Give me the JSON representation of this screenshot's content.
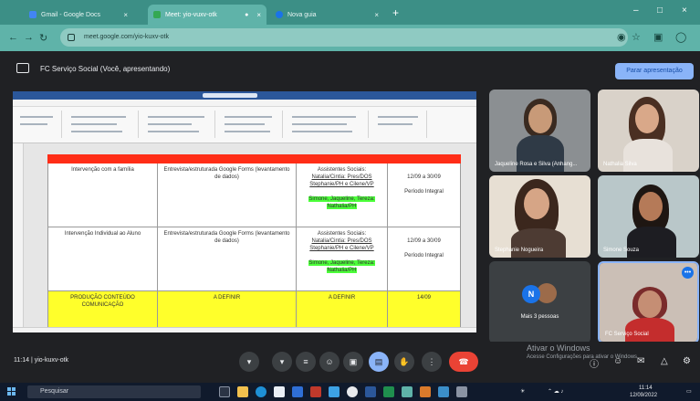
{
  "browser": {
    "tabs": [
      {
        "label": "Gmail - Google Docs",
        "favicon_color": "#4285f4"
      },
      {
        "label": "Meet: yio-vuxv-otk",
        "favicon_color": "#34a853"
      },
      {
        "label": "Nova guia",
        "favicon_color": "#1a73e8"
      }
    ],
    "new_tab": "+",
    "url": "meet.google.com/yio-kuxv-otk",
    "window_controls": [
      "–",
      "□",
      "×"
    ]
  },
  "meet": {
    "presentation_title": "FC Serviço Social (Você, apresentando)",
    "stop_button": "Parar apresentação",
    "meeting_code": "11:14  |  yio-kuxv-otk",
    "participants": [
      {
        "name": "Jaqueline Rosa e Silva (Anhang...",
        "bg": "#8b8f92"
      },
      {
        "name": "Nathalia Silva",
        "bg": "#d9d2c9"
      },
      {
        "name": "Stephanie Nogueira",
        "bg": "#e7dfd3"
      },
      {
        "name": "Simone Souza",
        "bg": "#b9c7c9"
      },
      {
        "name": "Mais 3 pessoas",
        "avatar_letter": "N"
      },
      {
        "name": "FC Serviço Social",
        "bg": "#cbbfb6"
      }
    ],
    "windows_activation": {
      "line1": "Ativar o Windows",
      "line2": "Acesse Configurações para ativar o Windows."
    }
  },
  "document": {
    "rows": [
      {
        "col1": "Intervenção com a família",
        "col2": "Entrevista/estruturada Google Forms (levantamento de dados)",
        "col3_title": "Assistentes Sociais:",
        "col3_names": [
          "Natalia/Cintia: Pres/DOS",
          "Stephanie/PH e Cilene/VP"
        ],
        "col3_green": "Simone, Jaqueline, Tereza: Nathalia/PH",
        "col4_date": "12/09 a 30/09",
        "col4_period": "Período Integral"
      },
      {
        "col1": "Intervenção Individual ao Aluno",
        "col2": "Entrevista/estruturada Google Forms (levantamento de dados)",
        "col3_title": "Assistentes Sociais:",
        "col3_names": [
          "Natalia/Cintia: Pres/DOS",
          "Stephanie/PH e Cilene/VP"
        ],
        "col3_green": "Simone, Jaqueline, Tereza: Nathalia/PH",
        "col4_date": "12/09 a 30/09",
        "col4_period": "Período Integral"
      },
      {
        "col1": "PRODUÇÃO CONTEÚDO COMUNICAÇÃO",
        "col2": "A DEFINIR",
        "col3_title": "A DEFINIR",
        "col4_date": "14/09"
      }
    ]
  },
  "taskbar": {
    "search_placeholder": "Pesquisar",
    "clock": "11:14",
    "date": "12/09/2022"
  }
}
